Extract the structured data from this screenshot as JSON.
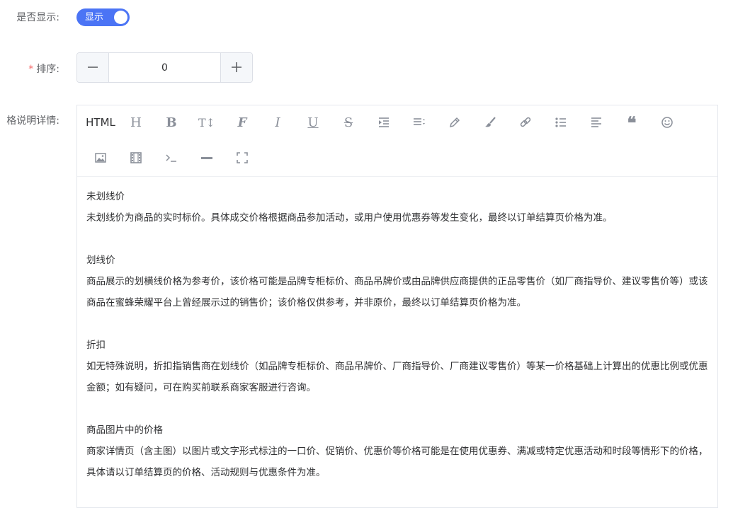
{
  "form": {
    "show_label": "是否显示:",
    "switch_text": "显示",
    "sort_label": "排序:",
    "sort_value": "0",
    "detail_label": "格说明详情:"
  },
  "toolbar": {
    "html_label": "HTML",
    "heading_label": "H",
    "bold_label": "B",
    "size_label": "T↕",
    "font_label": "F",
    "italic_label": "I",
    "underline_label": "U",
    "strike_label": "S",
    "quote_label": "❝"
  },
  "content": [
    {
      "title": "未划线价",
      "body": "未划线价为商品的实时标价。具体成交价格根据商品参加活动，或用户使用优惠券等发生变化，最终以订单结算页价格为准。"
    },
    {
      "title": "划线价",
      "body": "商品展示的划横线价格为参考价，该价格可能是品牌专柜标价、商品吊牌价或由品牌供应商提供的正品零售价（如厂商指导价、建议零售价等）或该商品在蜜蜂荣耀平台上曾经展示过的销售价；该价格仅供参考，并非原价，最终以订单结算页价格为准。"
    },
    {
      "title": "折扣",
      "body": "如无特殊说明，折扣指销售商在划线价（如品牌专柜标价、商品吊牌价、厂商指导价、厂商建议零售价）等某一价格基础上计算出的优惠比例或优惠金额；如有疑问，可在购买前联系商家客服进行咨询。"
    },
    {
      "title": "商品图片中的价格",
      "body": "商家详情页（含主图）以图片或文字形式标注的一口价、促销价、优惠价等价格可能是在使用优惠券、满减或特定优惠活动和时段等情形下的价格，具体请以订单结算页的价格、活动规则与优惠条件为准。"
    }
  ]
}
